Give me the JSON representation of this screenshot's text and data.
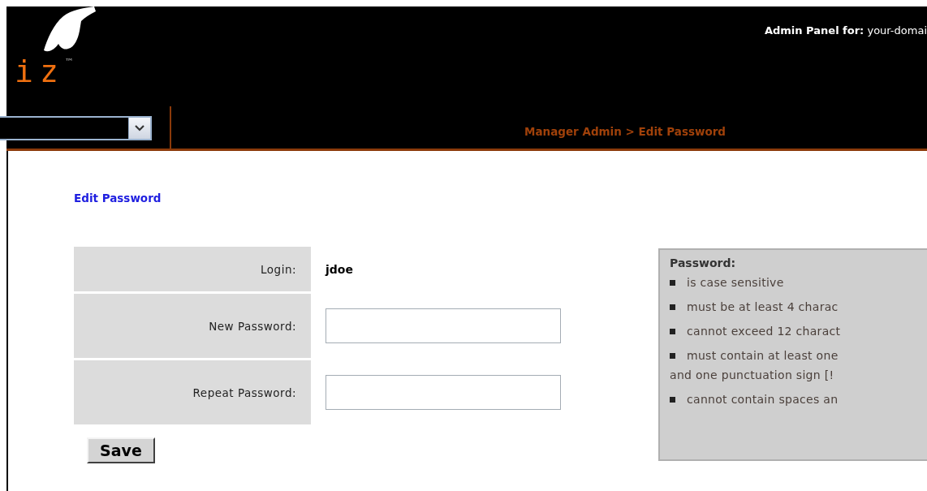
{
  "header": {
    "logo": {
      "text": "iz",
      "trademark": "™"
    },
    "admin_label": "Admin Panel for:",
    "domain": "your-domai",
    "breadcrumb": "Manager Admin > Edit Password"
  },
  "page_title": "Edit Password",
  "form": {
    "rows": [
      {
        "label": "Login:",
        "kind": "text",
        "value": "jdoe"
      },
      {
        "label": "New Password:",
        "kind": "input"
      },
      {
        "label": "Repeat Password:",
        "kind": "input"
      }
    ],
    "save": "Save"
  },
  "rules": {
    "title": "Password:",
    "items": [
      {
        "text": "is case sensitive"
      },
      {
        "text": "must be at least 4 charac"
      },
      {
        "text": "cannot exceed 12 charact"
      },
      {
        "text": "must contain at least one",
        "continuation": "and one punctuation sign [!"
      },
      {
        "text": "cannot contain spaces an"
      }
    ]
  }
}
